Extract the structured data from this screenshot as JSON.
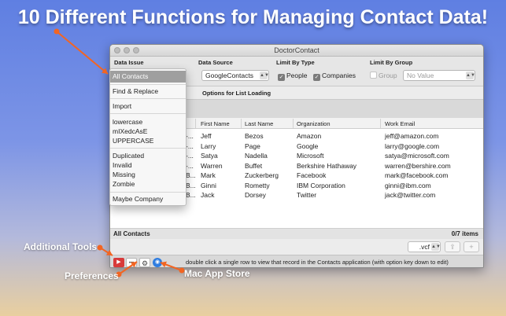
{
  "headline": "10 Different Functions for Managing Contact Data!",
  "window": {
    "title": "DoctorContact"
  },
  "filters": {
    "data_issue_label": "Data Issue",
    "data_source_label": "Data Source",
    "data_source_value": "GoogleContacts",
    "limit_type_label": "Limit By Type",
    "people_label": "People",
    "companies_label": "Companies",
    "limit_group_label": "Limit By Group",
    "group_label": "Group",
    "group_value": "No Value"
  },
  "options_label": "Options for List Loading",
  "dropdown": {
    "selected": "All Contacts",
    "groups": [
      [
        "Find & Replace"
      ],
      [
        "Import"
      ],
      [
        "lowercase",
        "mIXedcAsE",
        "UPPERCASE"
      ],
      [
        "Duplicated",
        "Invalid",
        "Missing",
        "Zombie"
      ],
      [
        "Maybe Company"
      ]
    ]
  },
  "table": {
    "columns": [
      "First Name",
      "Last Name",
      "Organization",
      "Work Email"
    ],
    "rows": [
      {
        "lead": "-...",
        "first": "Jeff",
        "last": "Bezos",
        "org": "Amazon",
        "email": "jeff@amazon.com"
      },
      {
        "lead": "-...",
        "first": "Larry",
        "last": "Page",
        "org": "Google",
        "email": "larry@google.com"
      },
      {
        "lead": "-...",
        "first": "Satya",
        "last": "Nadella",
        "org": "Microsoft",
        "email": "satya@microsoft.com"
      },
      {
        "lead": "-...",
        "first": "Warren",
        "last": "Buffet",
        "org": "Berkshire Hathaway",
        "email": "warren@bershire.com"
      },
      {
        "lead": "B...",
        "first": "Mark",
        "last": "Zuckerberg",
        "org": "Facebook",
        "email": "mark@facebook.com"
      },
      {
        "lead": "B...",
        "first": "Ginni",
        "last": "Rometty",
        "org": "IBM Corporation",
        "email": "ginni@ibm.com"
      },
      {
        "lead": "B...",
        "first": "Jack",
        "last": "Dorsey",
        "org": "Twitter",
        "email": "jack@twitter.com"
      }
    ]
  },
  "status": {
    "left": "All Contacts",
    "right": "0/7 items"
  },
  "export": {
    "format": ".vcf",
    "share_glyph": "⇪",
    "add_glyph": "+"
  },
  "bottom": {
    "hint": "double click a single row to view that record in the Contacts application (with option key down to edit)",
    "tool_glyphs": {
      "red": "▶",
      "more": "•••",
      "gear": "⚙",
      "globe": "◉"
    }
  },
  "callouts": {
    "additional_tools": "Additional Tools",
    "preferences": "Preferences",
    "mac_app_store": "Mac App Store"
  },
  "colors": {
    "accent_arrow": "#f26522",
    "background_top": "#5f7fe2",
    "background_bottom": "#e9cf9f"
  }
}
